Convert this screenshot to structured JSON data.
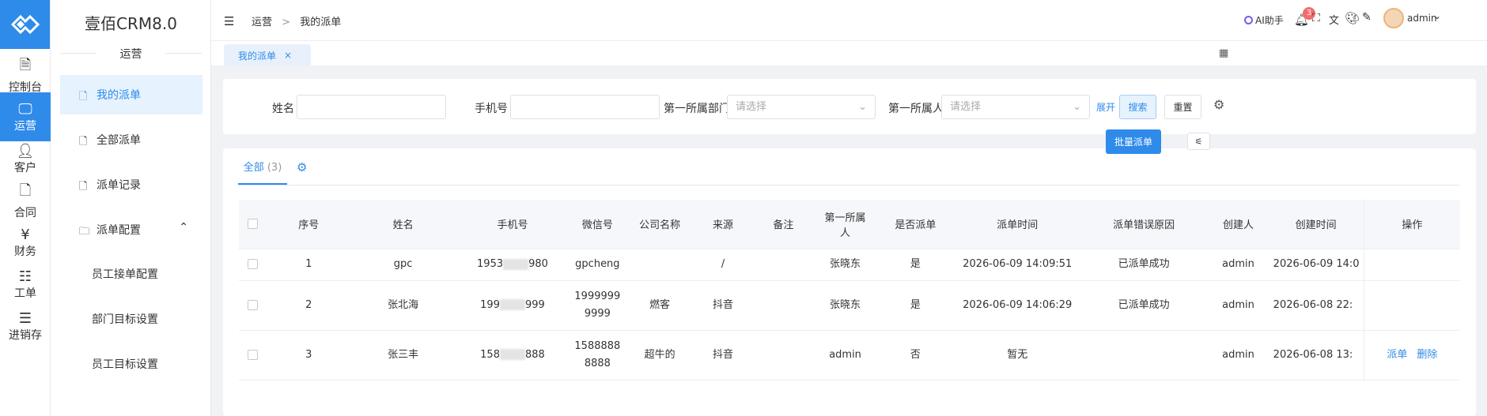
{
  "app": {
    "name": "壹佰CRM8.0",
    "section": "运营"
  },
  "rail": [
    {
      "label": "控制台",
      "icon": "dashboard-icon"
    },
    {
      "label": "运营",
      "icon": "monitor-icon",
      "active": true
    },
    {
      "label": "客户",
      "icon": "user-icon"
    },
    {
      "label": "合同",
      "icon": "contract-icon"
    },
    {
      "label": "财务",
      "icon": "finance-icon"
    },
    {
      "label": "工单",
      "icon": "ticket-icon"
    },
    {
      "label": "进销存",
      "icon": "list-icon"
    }
  ],
  "menu": {
    "items": [
      {
        "label": "我的派单",
        "active": true
      },
      {
        "label": "全部派单"
      },
      {
        "label": "派单记录"
      },
      {
        "label": "派单配置"
      }
    ],
    "sub": [
      "员工接单配置",
      "部门目标设置",
      "员工目标设置"
    ]
  },
  "header": {
    "breadcrumb": [
      "运营",
      ">",
      "我的派单"
    ],
    "ai": "AI助手",
    "badge": "3",
    "user": "admin"
  },
  "tab": {
    "label": "我的派单",
    "close": "×"
  },
  "filter": {
    "name_label": "姓名",
    "phone_label": "手机号",
    "dept_label": "第一所属部门",
    "dept_placeholder": "请选择",
    "person_label": "第一所属人",
    "person_placeholder": "请选择",
    "expand": "展开",
    "search": "搜索",
    "reset": "重置"
  },
  "list": {
    "tab_label": "全部",
    "tab_count": "(3)",
    "batch": "批量派单",
    "columns": [
      "序号",
      "姓名",
      "手机号",
      "微信号",
      "公司名称",
      "来源",
      "备注",
      "第一所属人",
      "是否派单",
      "派单时间",
      "派单错误原因",
      "创建人",
      "创建时间",
      "操作"
    ],
    "rows": [
      {
        "no": "1",
        "name": "gpc",
        "phone_a": "1953",
        "phone_b": "980",
        "wechat": "gpcheng",
        "company": "",
        "source": "/",
        "note": "",
        "owner": "张晓东",
        "dispatched": "是",
        "time": "2026-06-09 14:09:51",
        "reason": "已派单成功",
        "creator": "admin",
        "created": "2026-06-09 14:0",
        "actions": []
      },
      {
        "no": "2",
        "name": "张北海",
        "phone_a": "199",
        "phone_b": "999",
        "wechat": "1999999\n9999",
        "company": "燃客",
        "source": "抖音",
        "note": "",
        "owner": "张晓东",
        "dispatched": "是",
        "time": "2026-06-09 14:06:29",
        "reason": "已派单成功",
        "creator": "admin",
        "created": "2026-06-08 22:",
        "actions": []
      },
      {
        "no": "3",
        "name": "张三丰",
        "phone_a": "158",
        "phone_b": "888",
        "wechat": "1588888\n8888",
        "company": "超牛的",
        "source": "抖音",
        "note": "",
        "owner": "admin",
        "dispatched": "否",
        "time": "暂无",
        "reason": "",
        "creator": "admin",
        "created": "2026-06-08 13:",
        "actions": [
          "派单",
          "删除"
        ]
      }
    ]
  }
}
